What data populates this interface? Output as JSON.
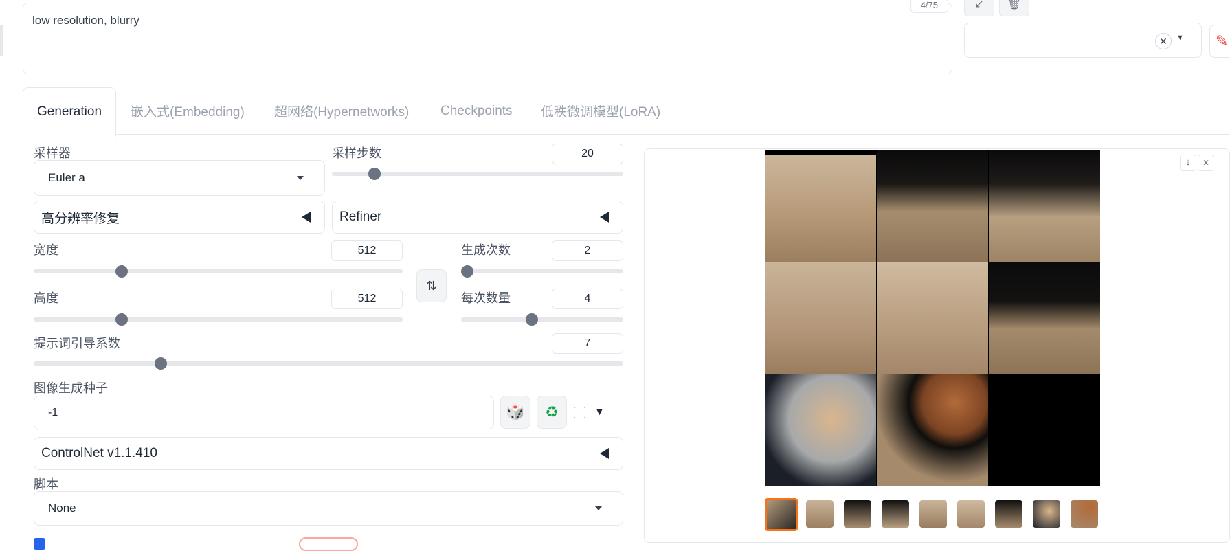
{
  "prompt": {
    "negative_text": "low resolution, blurry",
    "token_counter": "4/75"
  },
  "tabs": [
    {
      "label": "Generation",
      "active": true
    },
    {
      "label": "嵌入式(Embedding)"
    },
    {
      "label": "超网络(Hypernetworks)"
    },
    {
      "label": "Checkpoints"
    },
    {
      "label": "低秩微调模型(LoRA)"
    }
  ],
  "sampler": {
    "label": "采样器",
    "value": "Euler a"
  },
  "steps": {
    "label": "采样步数",
    "value": "20",
    "fraction": 0.13
  },
  "hires_fix": {
    "label": "高分辨率修复"
  },
  "refiner": {
    "label": "Refiner"
  },
  "width": {
    "label": "宽度",
    "value": "512",
    "fraction": 0.23
  },
  "height": {
    "label": "高度",
    "value": "512",
    "fraction": 0.23
  },
  "batch_count": {
    "label": "生成次数",
    "value": "2",
    "fraction": 0.0
  },
  "batch_size": {
    "label": "每次数量",
    "value": "4",
    "fraction": 0.43
  },
  "cfg": {
    "label": "提示词引导系数",
    "value": "7",
    "fraction": 0.21
  },
  "seed": {
    "label": "图像生成种子",
    "value": "-1"
  },
  "controlnet": {
    "label": "ControlNet v1.1.410"
  },
  "script": {
    "label": "脚本",
    "value": "None"
  },
  "colors": {
    "accent": "#f97316",
    "checkbox": "#2563eb"
  }
}
